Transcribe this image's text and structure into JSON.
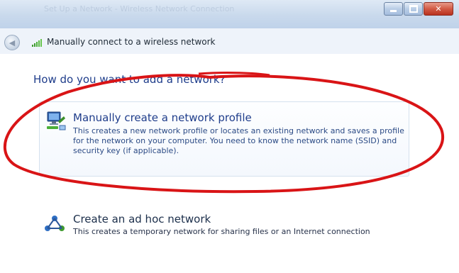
{
  "window": {
    "faded_title": "Set Up a Network - Wireless Network Connection"
  },
  "nav": {
    "title": "Manually connect to a wireless network"
  },
  "main": {
    "heading": "How do you want to add a network?",
    "options": [
      {
        "title": "Manually create a network profile",
        "description": "This creates a new network profile or locates an existing network and saves a profile for the network on your computer. You need to know the network name (SSID) and security key (if applicable)."
      },
      {
        "title": "Create an ad hoc network",
        "description": "This creates a temporary network for sharing files or an Internet connection"
      }
    ]
  },
  "icons": {
    "back": "back-arrow-icon",
    "signal": "wireless-signal-icon",
    "manual_profile": "network-computer-icon",
    "adhoc": "adhoc-network-icon"
  },
  "colors": {
    "heading": "#1f3d8b",
    "annotation": "#d91416",
    "close_button": "#c8432d"
  }
}
